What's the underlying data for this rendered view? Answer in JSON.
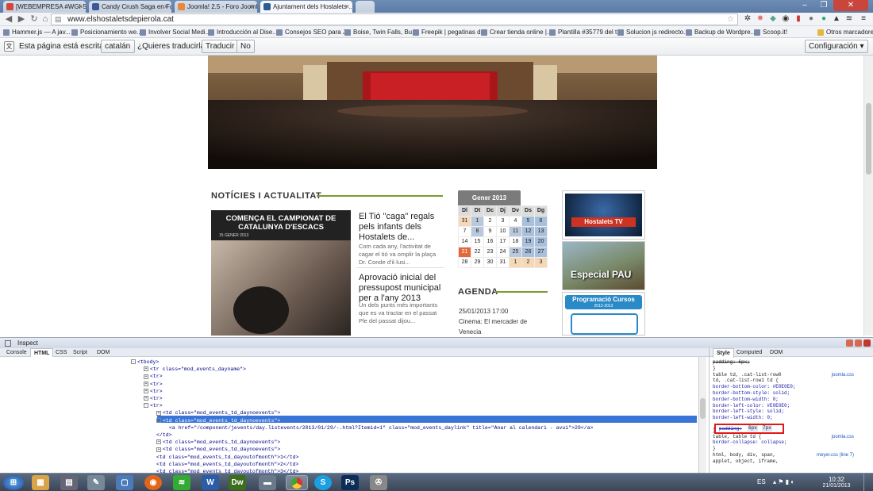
{
  "browser": {
    "tabs": [
      {
        "label": "[WEBEMPRESA #WGI-552]...",
        "color": "#d44638"
      },
      {
        "label": "Candy Crush Saga en Fac...",
        "color": "#3b5998"
      },
      {
        "label": "Joomla! 2.5 - Foro Joomla...",
        "color": "#e8893a"
      },
      {
        "label": "Ajuntament dels Hostalets ...",
        "color": "#2b5c8f"
      }
    ],
    "url": "www.elshostaletsdepierola.cat",
    "bookmarks": [
      "Hammer.js — A jav...",
      "Posicionamiento we...",
      "Involver Social Medi...",
      "Introducción al Dise...",
      "Consejos SEO para J...",
      "Boise, Twin Falls, Bu...",
      "Freepik | pegatinas d...",
      "Crear tienda online |...",
      "Plantilla #35779 del t...",
      "Solucion js redirecto...",
      "Backup de Wordpre...",
      "Scoop.it!"
    ],
    "bookmarks_other": "Otros marcadores"
  },
  "translate": {
    "prefix": "Esta página está escrita en",
    "language": "catalán",
    "question": "¿Quieres traducirla?",
    "translate_btn": "Traducir",
    "no_btn": "No",
    "config_btn": "Configuración"
  },
  "site": {
    "news_heading": "NOTÍCIES I ACTUALITAT",
    "feature_title": "COMENÇA EL CAMPIONAT DE CATALUNYA D'ESCACS",
    "feature_date": "15 GENER 2013",
    "articles": [
      {
        "title": "El Tió \"caga\" regals pels infants dels Hostalets de...",
        "summary": "Com cada any, l'activitat de cagar el tió va omplir la plaça Dr. Conde d'il·lusi..."
      },
      {
        "title": "Aprovació inicial del pressupost municipal per a l'any 2013",
        "summary": "Un dels punts més importants que es va tractar en el passat Ple del passat dijou..."
      }
    ],
    "calendar": {
      "title": "Gener 2013",
      "days": [
        "Dl",
        "Dt",
        "Dc",
        "Dj",
        "Dv",
        "Ds",
        "Dg"
      ],
      "weeks": [
        [
          "31",
          "1",
          "2",
          "3",
          "4",
          "5",
          "6"
        ],
        [
          "7",
          "8",
          "9",
          "10",
          "11",
          "12",
          "13"
        ],
        [
          "14",
          "15",
          "16",
          "17",
          "18",
          "19",
          "20"
        ],
        [
          "21",
          "22",
          "23",
          "24",
          "25",
          "26",
          "27"
        ],
        [
          "28",
          "29",
          "30",
          "31",
          "1",
          "2",
          "3"
        ]
      ]
    },
    "agenda_heading": "AGENDA",
    "agenda_date": "25/01/2013 17:00",
    "agenda_text": "Cinema: El mercader de Venecia",
    "banners": [
      "Hostalets TV",
      "Especial PAU",
      "Programació Cursos",
      "2012-2013"
    ]
  },
  "devtools": {
    "title": "Inspect",
    "tabs": [
      "Console",
      "HTML",
      "CSS",
      "Script",
      "DOM"
    ],
    "right_tabs": [
      "Style",
      "Computed",
      "DOM"
    ],
    "html_lines": [
      {
        "indent": 0,
        "text": "<tbody>",
        "toggle": "-"
      },
      {
        "indent": 1,
        "text": "<tr class=\"mod_events_dayname\">",
        "toggle": "+"
      },
      {
        "indent": 1,
        "text": "<tr>",
        "toggle": "+"
      },
      {
        "indent": 1,
        "text": "<tr>",
        "toggle": "+"
      },
      {
        "indent": 1,
        "text": "<tr>",
        "toggle": "+"
      },
      {
        "indent": 1,
        "text": "<tr>",
        "toggle": "+"
      },
      {
        "indent": 1,
        "text": "<tr>",
        "toggle": "-"
      },
      {
        "indent": 2,
        "text": "<td class=\"mod_events_td_daynoevents\">",
        "toggle": "+"
      },
      {
        "indent": 2,
        "text": "<td class=\"mod_events_td_daynoevents\">",
        "toggle": "-",
        "selected": true
      },
      {
        "indent": 3,
        "text": "<a href=\"/component/jevents/day.listevents/2013/01/29/-.html?Itemid=1\" class=\"mod_events_daylink\" title=\"Anar al calendari - avui\">29</a>",
        "toggle": ""
      },
      {
        "indent": 2,
        "text": "</td>",
        "toggle": ""
      },
      {
        "indent": 2,
        "text": "<td class=\"mod_events_td_daynoevents\">",
        "toggle": "+"
      },
      {
        "indent": 2,
        "text": "<td class=\"mod_events_td_daynoevents\">",
        "toggle": "+"
      },
      {
        "indent": 2,
        "text": "<td class=\"mod_events_td_dayoutofmonth\">1</td>",
        "toggle": ""
      },
      {
        "indent": 2,
        "text": "<td class=\"mod_events_td_dayoutofmonth\">2</td>",
        "toggle": ""
      },
      {
        "indent": 2,
        "text": "<td class=\"mod_events_td_dayoutofmonth\">3</td>",
        "toggle": ""
      }
    ],
    "css_lines": [
      {
        "text": "padding: 6px;",
        "strike": true
      },
      {
        "text": "}"
      },
      {
        "text": "table td, .cat-list-row0",
        "source": "joomla.css"
      },
      {
        "text": "td, .cat-list-row1 td {"
      },
      {
        "text": "  border-bottom-color: #E0E0E0;"
      },
      {
        "text": "  border-bottom-style: solid;"
      },
      {
        "text": "  border-bottom-width: 0;"
      },
      {
        "text": "  border-left-color: #E0E0E0;"
      },
      {
        "text": "  border-left-style: solid;"
      },
      {
        "text": "  border-left-width: 0;"
      },
      {
        "text": "  padding: 6px 7px;",
        "highlight": true
      },
      {
        "text": "}"
      },
      {
        "text": "table, table td {",
        "source": "joomla.css"
      },
      {
        "text": "  border-collapse: collapse;"
      },
      {
        "text": "}"
      },
      {
        "text": "html, body, div, span,",
        "source": "meyer.css (line 7)"
      },
      {
        "text": "applet, object, iframe,"
      }
    ],
    "padding_edit": {
      "prop": "padding:",
      "v1": "6px",
      "v2": "7px"
    }
  },
  "taskbar": {
    "apps": [
      "Start",
      "Explorer",
      "Calculator",
      "Notes",
      "Firefox",
      "Spotify",
      "Word",
      "Dreamweaver",
      "Storage",
      "Chrome",
      "Skype",
      "Photoshop",
      "Tool"
    ],
    "lang": "ES",
    "time": "10:32",
    "date": "21/01/2013"
  }
}
